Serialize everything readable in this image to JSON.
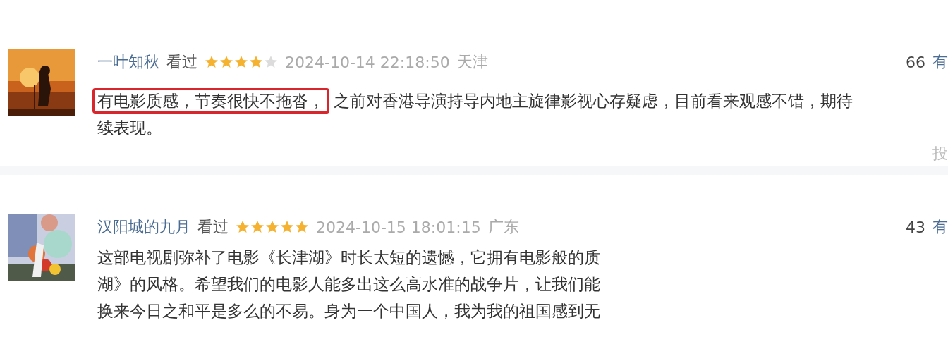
{
  "reviews": [
    {
      "avatar": {
        "kind": "picture"
      },
      "user": "一叶知秋",
      "status": "看过",
      "stars": 4,
      "time": "2024-10-14 22:18:50",
      "location": "天津",
      "votes": "66",
      "vote_label": "有",
      "lines": [
        {
          "highlight": "有电影质感，节奏很快不拖沓，",
          "text": "之前对香港导演持导内地主旋律影视心存疑虑，目前看来观感不错，期待"
        },
        {
          "text": "续表现。"
        }
      ],
      "action": "投"
    },
    {
      "avatar": {
        "kind": "picture"
      },
      "user": "汉阳城的九月",
      "status": "看过",
      "stars": 5,
      "time": "2024-10-15 18:01:15",
      "location": "广东",
      "votes": "43",
      "vote_label": "有",
      "lines": [
        {
          "text": "这部电视剧弥补了电影《长津湖》时长太短的遗憾，它拥有电影般的质"
        },
        {
          "text": "湖》的风格。希望我们的电影人能多出这么高水准的战争片，让我们能"
        },
        {
          "text": "换来今日之和平是多么的不易。身为一个中国人，我为我的祖国感到无"
        }
      ]
    }
  ]
}
